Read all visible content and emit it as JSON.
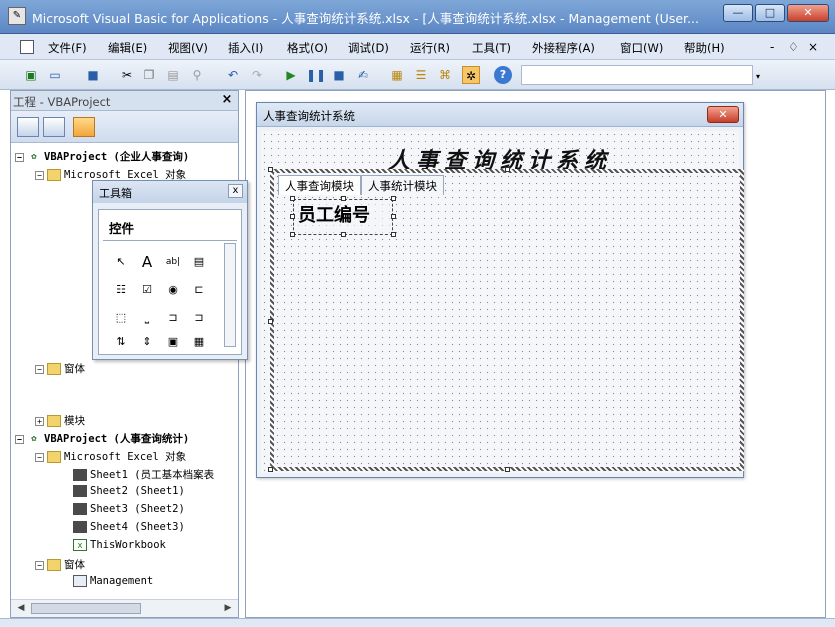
{
  "window": {
    "title": "Microsoft Visual Basic for Applications - 人事查询统计系统.xlsx - [人事查询统计系统.xlsx - Management (User...",
    "min_label": "—",
    "max_label": "□",
    "close_label": "✕"
  },
  "menu": {
    "items": [
      "文件(F)",
      "编辑(E)",
      "视图(V)",
      "插入(I)",
      "格式(O)",
      "调试(D)",
      "运行(R)",
      "工具(T)",
      "外接程序(A)",
      "窗口(W)",
      "帮助(H)"
    ],
    "mdi_min": "-",
    "mdi_restore": "♢",
    "mdi_close": "×"
  },
  "toolbar": {
    "icons": [
      "excel-icon",
      "insert-userform-icon",
      "save-icon",
      "cut-icon",
      "copy-icon",
      "paste-icon",
      "find-icon",
      "undo-icon",
      "redo-icon",
      "run-icon",
      "break-icon",
      "reset-icon",
      "design-mode-icon",
      "project-explorer-icon",
      "properties-icon",
      "object-browser-icon",
      "toolbox-icon",
      "help-icon"
    ],
    "help_label": "?"
  },
  "project_explorer": {
    "title": "工程 - VBAProject",
    "close_label": "×",
    "tree": [
      {
        "label": "VBAProject (企业人事查询)",
        "kind": "project",
        "level": 0
      },
      {
        "label": "Microsoft Excel 对象",
        "kind": "folder",
        "level": 1
      },
      {
        "label": "窗体",
        "kind": "folder",
        "level": 1
      },
      {
        "label": "模块",
        "kind": "folder",
        "level": 1
      },
      {
        "label": "VBAProject (人事查询统计)",
        "kind": "project",
        "level": 0
      },
      {
        "label": "Microsoft Excel 对象",
        "kind": "folder",
        "level": 1
      },
      {
        "label": "Sheet1 (员工基本档案表",
        "kind": "sheet",
        "level": 2
      },
      {
        "label": "Sheet2 (Sheet1)",
        "kind": "sheet",
        "level": 2
      },
      {
        "label": "Sheet3 (Sheet2)",
        "kind": "sheet",
        "level": 2
      },
      {
        "label": "Sheet4 (Sheet3)",
        "kind": "sheet",
        "level": 2
      },
      {
        "label": "ThisWorkbook",
        "kind": "book",
        "level": 2
      },
      {
        "label": "窗体",
        "kind": "folder",
        "level": 1
      },
      {
        "label": "Management",
        "kind": "form",
        "level": 2
      }
    ]
  },
  "toolbox": {
    "title": "工具箱",
    "close_label": "x",
    "tab_label": "控件",
    "tools": [
      "pointer-tool",
      "label-tool",
      "textbox-tool",
      "combobox-tool",
      "listbox-tool",
      "checkbox-tool",
      "optionbutton-tool",
      "togglebutton-tool",
      "frame-tool",
      "commandbutton-tool",
      "tabstrip-tool",
      "multipage-tool",
      "scrollbar-tool",
      "spinbutton-tool",
      "image-tool",
      "refedit-tool"
    ],
    "tool_glyphs": [
      "↖",
      "A",
      "ab|",
      "▤",
      "☷",
      "☑",
      "◉",
      "⊏",
      "⬚",
      "⎵",
      "⊐",
      "⊐",
      "⇅",
      "⇕",
      "▣",
      "▦"
    ]
  },
  "userform": {
    "title": "人事查询统计系统",
    "close_label": "✕",
    "heading": "人事查询统计系统",
    "tabs": [
      "人事查询模块",
      "人事统计模块"
    ],
    "label_caption": "员工编号"
  }
}
